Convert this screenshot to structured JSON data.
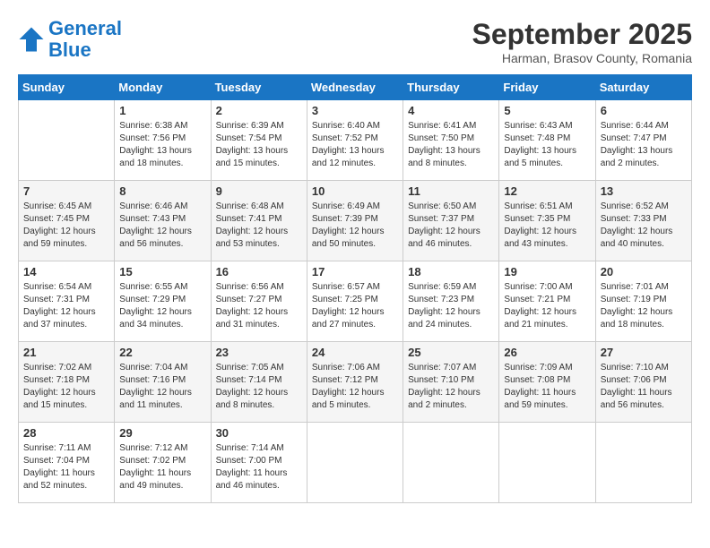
{
  "header": {
    "logo_line1": "General",
    "logo_line2": "Blue",
    "month": "September 2025",
    "location": "Harman, Brasov County, Romania"
  },
  "days_of_week": [
    "Sunday",
    "Monday",
    "Tuesday",
    "Wednesday",
    "Thursday",
    "Friday",
    "Saturday"
  ],
  "weeks": [
    [
      {
        "num": "",
        "info": ""
      },
      {
        "num": "1",
        "info": "Sunrise: 6:38 AM\nSunset: 7:56 PM\nDaylight: 13 hours\nand 18 minutes."
      },
      {
        "num": "2",
        "info": "Sunrise: 6:39 AM\nSunset: 7:54 PM\nDaylight: 13 hours\nand 15 minutes."
      },
      {
        "num": "3",
        "info": "Sunrise: 6:40 AM\nSunset: 7:52 PM\nDaylight: 13 hours\nand 12 minutes."
      },
      {
        "num": "4",
        "info": "Sunrise: 6:41 AM\nSunset: 7:50 PM\nDaylight: 13 hours\nand 8 minutes."
      },
      {
        "num": "5",
        "info": "Sunrise: 6:43 AM\nSunset: 7:48 PM\nDaylight: 13 hours\nand 5 minutes."
      },
      {
        "num": "6",
        "info": "Sunrise: 6:44 AM\nSunset: 7:47 PM\nDaylight: 13 hours\nand 2 minutes."
      }
    ],
    [
      {
        "num": "7",
        "info": "Sunrise: 6:45 AM\nSunset: 7:45 PM\nDaylight: 12 hours\nand 59 minutes."
      },
      {
        "num": "8",
        "info": "Sunrise: 6:46 AM\nSunset: 7:43 PM\nDaylight: 12 hours\nand 56 minutes."
      },
      {
        "num": "9",
        "info": "Sunrise: 6:48 AM\nSunset: 7:41 PM\nDaylight: 12 hours\nand 53 minutes."
      },
      {
        "num": "10",
        "info": "Sunrise: 6:49 AM\nSunset: 7:39 PM\nDaylight: 12 hours\nand 50 minutes."
      },
      {
        "num": "11",
        "info": "Sunrise: 6:50 AM\nSunset: 7:37 PM\nDaylight: 12 hours\nand 46 minutes."
      },
      {
        "num": "12",
        "info": "Sunrise: 6:51 AM\nSunset: 7:35 PM\nDaylight: 12 hours\nand 43 minutes."
      },
      {
        "num": "13",
        "info": "Sunrise: 6:52 AM\nSunset: 7:33 PM\nDaylight: 12 hours\nand 40 minutes."
      }
    ],
    [
      {
        "num": "14",
        "info": "Sunrise: 6:54 AM\nSunset: 7:31 PM\nDaylight: 12 hours\nand 37 minutes."
      },
      {
        "num": "15",
        "info": "Sunrise: 6:55 AM\nSunset: 7:29 PM\nDaylight: 12 hours\nand 34 minutes."
      },
      {
        "num": "16",
        "info": "Sunrise: 6:56 AM\nSunset: 7:27 PM\nDaylight: 12 hours\nand 31 minutes."
      },
      {
        "num": "17",
        "info": "Sunrise: 6:57 AM\nSunset: 7:25 PM\nDaylight: 12 hours\nand 27 minutes."
      },
      {
        "num": "18",
        "info": "Sunrise: 6:59 AM\nSunset: 7:23 PM\nDaylight: 12 hours\nand 24 minutes."
      },
      {
        "num": "19",
        "info": "Sunrise: 7:00 AM\nSunset: 7:21 PM\nDaylight: 12 hours\nand 21 minutes."
      },
      {
        "num": "20",
        "info": "Sunrise: 7:01 AM\nSunset: 7:19 PM\nDaylight: 12 hours\nand 18 minutes."
      }
    ],
    [
      {
        "num": "21",
        "info": "Sunrise: 7:02 AM\nSunset: 7:18 PM\nDaylight: 12 hours\nand 15 minutes."
      },
      {
        "num": "22",
        "info": "Sunrise: 7:04 AM\nSunset: 7:16 PM\nDaylight: 12 hours\nand 11 minutes."
      },
      {
        "num": "23",
        "info": "Sunrise: 7:05 AM\nSunset: 7:14 PM\nDaylight: 12 hours\nand 8 minutes."
      },
      {
        "num": "24",
        "info": "Sunrise: 7:06 AM\nSunset: 7:12 PM\nDaylight: 12 hours\nand 5 minutes."
      },
      {
        "num": "25",
        "info": "Sunrise: 7:07 AM\nSunset: 7:10 PM\nDaylight: 12 hours\nand 2 minutes."
      },
      {
        "num": "26",
        "info": "Sunrise: 7:09 AM\nSunset: 7:08 PM\nDaylight: 11 hours\nand 59 minutes."
      },
      {
        "num": "27",
        "info": "Sunrise: 7:10 AM\nSunset: 7:06 PM\nDaylight: 11 hours\nand 56 minutes."
      }
    ],
    [
      {
        "num": "28",
        "info": "Sunrise: 7:11 AM\nSunset: 7:04 PM\nDaylight: 11 hours\nand 52 minutes."
      },
      {
        "num": "29",
        "info": "Sunrise: 7:12 AM\nSunset: 7:02 PM\nDaylight: 11 hours\nand 49 minutes."
      },
      {
        "num": "30",
        "info": "Sunrise: 7:14 AM\nSunset: 7:00 PM\nDaylight: 11 hours\nand 46 minutes."
      },
      {
        "num": "",
        "info": ""
      },
      {
        "num": "",
        "info": ""
      },
      {
        "num": "",
        "info": ""
      },
      {
        "num": "",
        "info": ""
      }
    ]
  ]
}
